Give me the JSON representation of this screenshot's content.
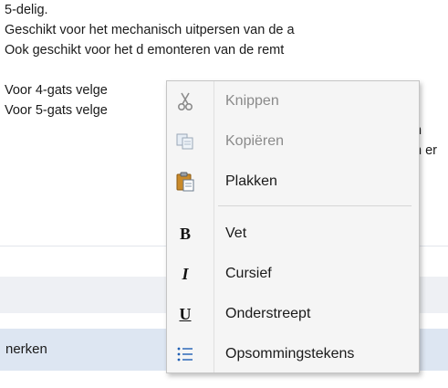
{
  "document": {
    "lines": [
      "5-delig.",
      "Geschikt voor het mechanisch uitpersen van de a",
      "Ook geschikt voor het d emonteren van de remt",
      "",
      "Voor 4-gats velge",
      "Voor 5-gats velge"
    ],
    "right_fragments": {
      "line5": "n",
      "line6": "n er"
    }
  },
  "background": {
    "field_label": "nerken"
  },
  "context_menu": {
    "items": [
      {
        "label": "Knippen",
        "icon": "scissors-icon",
        "enabled": false
      },
      {
        "label": "Kopiëren",
        "icon": "copy-icon",
        "enabled": false
      },
      {
        "label": "Plakken",
        "icon": "paste-icon",
        "enabled": true
      },
      {
        "label": "Vet",
        "icon": "bold-icon",
        "glyph": "B",
        "enabled": true
      },
      {
        "label": "Cursief",
        "icon": "italic-icon",
        "glyph": "I",
        "enabled": true
      },
      {
        "label": "Onderstreept",
        "icon": "underline-icon",
        "glyph": "U",
        "enabled": true
      },
      {
        "label": "Opsommingstekens",
        "icon": "bullet-list-icon",
        "enabled": true
      }
    ]
  },
  "colors": {
    "menu_bg": "#f5f5f5",
    "disabled_text": "#8a8a8a",
    "band_blue": "#dde6f2"
  }
}
